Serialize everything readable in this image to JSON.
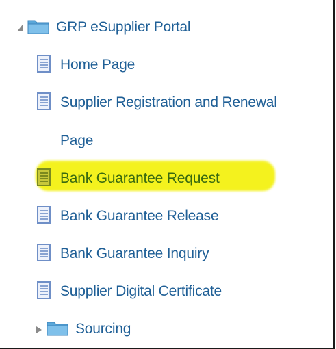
{
  "tree": {
    "root": {
      "label": "GRP eSupplier Portal",
      "expanded": true,
      "toggle_icon": "triangle-expanded-icon",
      "icon": "folder-icon"
    },
    "items": [
      {
        "label": "Home Page",
        "icon": "document-icon"
      },
      {
        "label": "Supplier Registration and Renewal",
        "icon": "document-icon"
      },
      {
        "label": "Page",
        "icon": "none"
      },
      {
        "label": "Bank Guarantee Request",
        "icon": "document-icon",
        "highlighted": true
      },
      {
        "label": "Bank Guarantee Release",
        "icon": "document-icon"
      },
      {
        "label": "Bank Guarantee Inquiry",
        "icon": "document-icon"
      },
      {
        "label": "Supplier Digital Certificate",
        "icon": "document-icon"
      }
    ],
    "subfolder": {
      "label": "Sourcing",
      "expanded": false,
      "toggle_icon": "triangle-collapsed-icon",
      "icon": "folder-icon"
    }
  },
  "colors": {
    "link": "#1f5f96",
    "highlight": "#f4f21e",
    "folder": "#5aa7d9",
    "document": "#6f8fc7"
  }
}
